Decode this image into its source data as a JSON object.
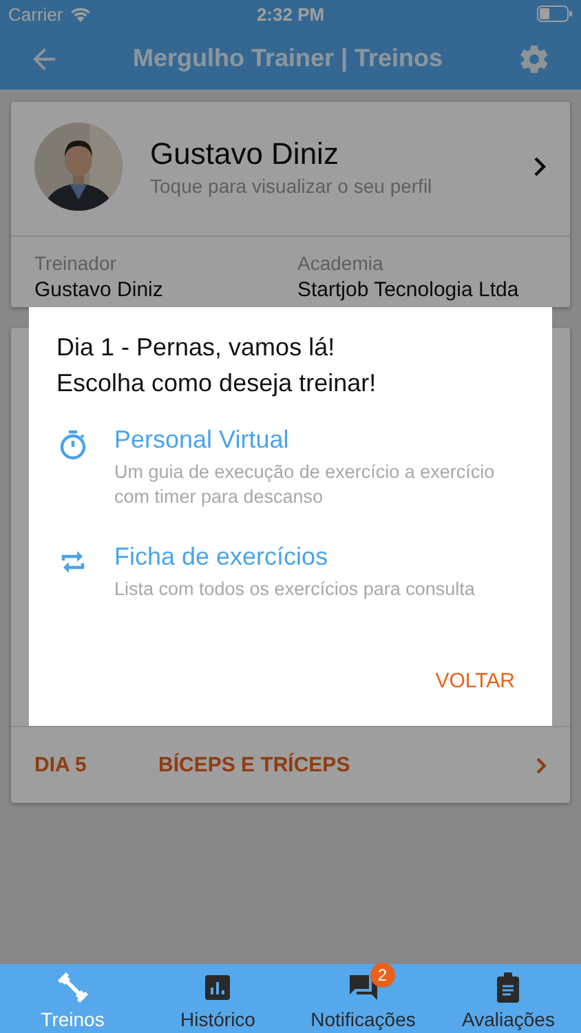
{
  "status_bar": {
    "carrier": "Carrier",
    "time": "2:32 PM"
  },
  "header": {
    "title": "Mergulho Trainer | Treinos"
  },
  "profile": {
    "name": "Gustavo Diniz",
    "subtitle": "Toque para visualizar o seu perfil",
    "trainer_label": "Treinador",
    "trainer": "Gustavo Diniz",
    "gym_label": "Academia",
    "gym": "Startjob Tecnologia Ltda"
  },
  "workouts": [
    {
      "day": "DIA 5",
      "name": "BÍCEPS E TRÍCEPS"
    }
  ],
  "dialog": {
    "lines": [
      "Dia 1 - Pernas, vamos lá!",
      "Escolha como deseja treinar!"
    ],
    "options": [
      {
        "kind": "timer",
        "title": "Personal Virtual",
        "description": "Um guia de execução de exercício a exercício com timer para descanso"
      },
      {
        "kind": "repeat",
        "title": "Ficha de exercícios",
        "description": "Lista com todos os exercícios para consulta"
      }
    ],
    "button": "VOLTAR"
  },
  "tabs": [
    {
      "kind": "dumbbell",
      "label": "Treinos",
      "selected": true
    },
    {
      "kind": "chart",
      "label": "Histórico",
      "selected": false
    },
    {
      "kind": "chat",
      "label": "Notificações",
      "selected": false,
      "badge": "2"
    },
    {
      "kind": "clipboard",
      "label": "Avaliações",
      "selected": false
    }
  ]
}
